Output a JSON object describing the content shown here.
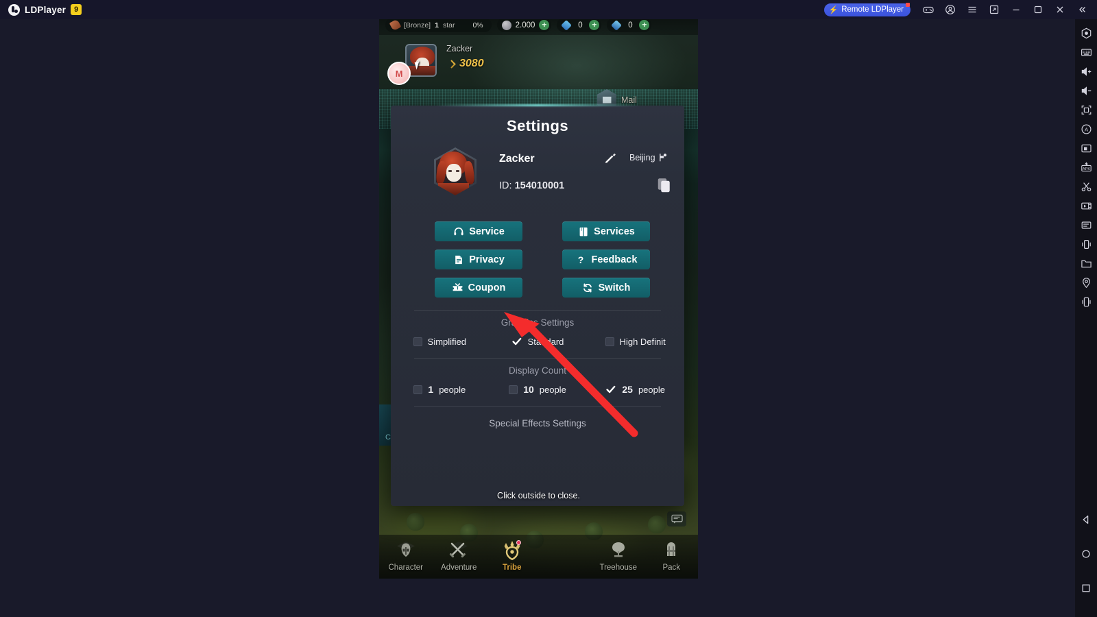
{
  "titlebar": {
    "brand": "LDPlayer",
    "brand_badge": "9",
    "remote_label": "Remote LDPlayer",
    "icons": [
      "gamepad-icon",
      "account-icon",
      "menu-icon",
      "new-window-icon",
      "minimize-icon",
      "maximize-icon",
      "close-icon",
      "collapse-icon"
    ]
  },
  "game": {
    "topbar": {
      "rank_prefix": "[Bronze]",
      "rank_star": "1",
      "rank_star_unit": "star",
      "rank_percent": "0%",
      "coins": "2.000",
      "gem_blue": "0",
      "gem_cyan": "0",
      "plus": "+"
    },
    "player": {
      "name": "Zacker",
      "power": "3080",
      "badge": "M"
    },
    "mail_label": "Mail",
    "left_tab_label": "C",
    "click_outside": "Click outside to close.",
    "bottom_nav": [
      {
        "label": "Character",
        "icon": "helmet-icon",
        "active": false,
        "badge": false
      },
      {
        "label": "Adventure",
        "icon": "crossed-swords-icon",
        "active": false,
        "badge": false
      },
      {
        "label": "Tribe",
        "icon": "tribe-emblem-icon",
        "active": true,
        "badge": true
      },
      {
        "label": "",
        "icon": "empty-slot-icon",
        "active": false,
        "badge": false
      },
      {
        "label": "Treehouse",
        "icon": "tree-icon",
        "active": false,
        "badge": false
      },
      {
        "label": "Pack",
        "icon": "backpack-icon",
        "active": false,
        "badge": false
      }
    ]
  },
  "settings": {
    "title": "Settings",
    "profile": {
      "name": "Zacker",
      "id_label": "ID:",
      "id_value": "154010001",
      "location": "Beijing",
      "edit_icon": "pencil-icon",
      "location_icon": "flag-icon",
      "copy_icon": "copy-icon",
      "avatar_icon": "avatar-hexagon"
    },
    "buttons": [
      {
        "label": "Service",
        "icon": "headset-icon"
      },
      {
        "label": "Services",
        "icon": "book-icon"
      },
      {
        "label": "Privacy",
        "icon": "document-icon"
      },
      {
        "label": "Feedback",
        "icon": "question-mark-icon"
      },
      {
        "label": "Coupon",
        "icon": "ticket-icon"
      },
      {
        "label": "Switch",
        "icon": "refresh-icon"
      }
    ],
    "graphics": {
      "title": "Graphics Settings",
      "options": [
        {
          "label": "Simplified",
          "checked": false
        },
        {
          "label": "Standard",
          "checked": true
        },
        {
          "label": "High Definit",
          "checked": false
        }
      ]
    },
    "display_count": {
      "title": "Display Count",
      "options": [
        {
          "value": "1",
          "unit": "people",
          "checked": false
        },
        {
          "value": "10",
          "unit": "people",
          "checked": false
        },
        {
          "value": "25",
          "unit": "people",
          "checked": true
        }
      ]
    },
    "special_effects": "Special Effects Settings"
  },
  "sidebar": {
    "icons": [
      "settings-hexagon-icon",
      "keyboard-icon",
      "volume-up-icon",
      "volume-down-icon",
      "fullscreen-icon",
      "auto-rotate-icon",
      "screenshot-save-icon",
      "apk-install-icon",
      "scissors-icon",
      "video-record-icon",
      "multi-window-icon",
      "shake-icon",
      "folder-icon",
      "location-pin-icon",
      "virtual-device-icon"
    ],
    "nav_icons": [
      "back-triangle-icon",
      "home-circle-icon",
      "recents-square-icon"
    ]
  },
  "colors": {
    "accent_teal": "#17737d",
    "remote_blue": "#4a63e8",
    "arrow_red": "#f42c2c",
    "active_gold": "#dba53e",
    "brand_yellow": "#f5cf1d"
  }
}
